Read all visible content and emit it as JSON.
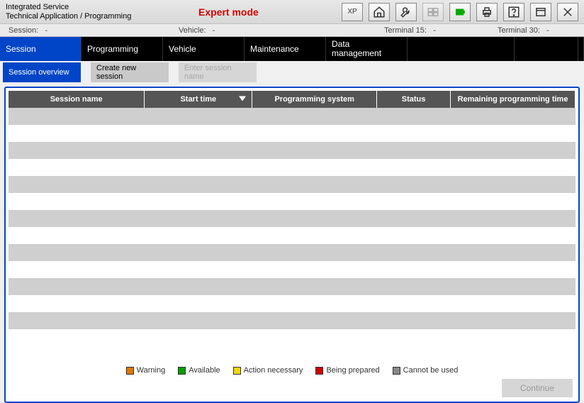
{
  "header": {
    "title_line1": "Integrated Service",
    "title_line2": "Technical Application / Programming",
    "mode_label": "Expert mode",
    "toolbar": {
      "xp": "XP"
    }
  },
  "infobar": {
    "session_label": "Session:",
    "session_value": "-",
    "vehicle_label": "Vehicle:",
    "vehicle_value": "-",
    "terminal15_label": "Terminal 15:",
    "terminal15_value": "-",
    "terminal30_label": "Terminal 30:",
    "terminal30_value": "-"
  },
  "maintabs": [
    {
      "label": "Session",
      "active": true
    },
    {
      "label": "Programming"
    },
    {
      "label": "Vehicle"
    },
    {
      "label": "Maintenance"
    },
    {
      "label": "Data management"
    }
  ],
  "subtabs": {
    "overview": "Session overview",
    "create": "Create new session",
    "enter": "Enter session name"
  },
  "table": {
    "columns": {
      "session_name": "Session name",
      "start_time": "Start time",
      "programming_system": "Programming system",
      "status": "Status",
      "remaining": "Remaining programming time"
    },
    "col_widths": [
      "24%",
      "19%",
      "22%",
      "13%",
      "22%"
    ],
    "rows": [
      {
        "session_name": "",
        "start_time": "",
        "programming_system": "",
        "status": "",
        "remaining": ""
      },
      {
        "session_name": "",
        "start_time": "",
        "programming_system": "",
        "status": "",
        "remaining": ""
      },
      {
        "session_name": "",
        "start_time": "",
        "programming_system": "",
        "status": "",
        "remaining": ""
      },
      {
        "session_name": "",
        "start_time": "",
        "programming_system": "",
        "status": "",
        "remaining": ""
      },
      {
        "session_name": "",
        "start_time": "",
        "programming_system": "",
        "status": "",
        "remaining": ""
      },
      {
        "session_name": "",
        "start_time": "",
        "programming_system": "",
        "status": "",
        "remaining": ""
      },
      {
        "session_name": "",
        "start_time": "",
        "programming_system": "",
        "status": "",
        "remaining": ""
      },
      {
        "session_name": "",
        "start_time": "",
        "programming_system": "",
        "status": "",
        "remaining": ""
      },
      {
        "session_name": "",
        "start_time": "",
        "programming_system": "",
        "status": "",
        "remaining": ""
      },
      {
        "session_name": "",
        "start_time": "",
        "programming_system": "",
        "status": "",
        "remaining": ""
      },
      {
        "session_name": "",
        "start_time": "",
        "programming_system": "",
        "status": "",
        "remaining": ""
      },
      {
        "session_name": "",
        "start_time": "",
        "programming_system": "",
        "status": "",
        "remaining": ""
      },
      {
        "session_name": "",
        "start_time": "",
        "programming_system": "",
        "status": "",
        "remaining": ""
      },
      {
        "session_name": "",
        "start_time": "",
        "programming_system": "",
        "status": "",
        "remaining": ""
      }
    ]
  },
  "legend": {
    "warning": {
      "label": "Warning",
      "color": "#e07800"
    },
    "available": {
      "label": "Available",
      "color": "#00a000"
    },
    "action": {
      "label": "Action necessary",
      "color": "#f0d800"
    },
    "being_prepared": {
      "label": "Being prepared",
      "color": "#d00000"
    },
    "cannot": {
      "label": "Cannot be used",
      "color": "#888888"
    }
  },
  "footer": {
    "continue": "Continue"
  }
}
